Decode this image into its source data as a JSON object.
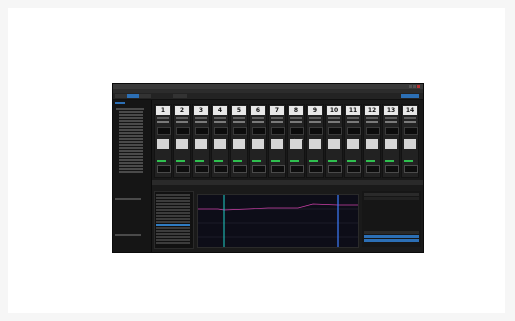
{
  "app": {
    "title": "",
    "menu": [
      "",
      "",
      "",
      "",
      "",
      ""
    ],
    "toolbar": {
      "items": [
        "",
        "",
        "",
        ""
      ],
      "active_index": 1
    }
  },
  "mixer": {
    "channels": [
      "1",
      "2",
      "3",
      "4",
      "5",
      "6",
      "7",
      "8",
      "9",
      "10",
      "11",
      "12",
      "13",
      "14"
    ]
  },
  "bottom": {
    "tabs": [
      "",
      "",
      "",
      "",
      "",
      ""
    ],
    "list_selected_index": 10
  },
  "colors": {
    "accent": "#2c6fb5",
    "meter_green": "#2fbf4f",
    "graph_cursor_teal": "#1fd1c8",
    "graph_cursor_blue": "#3d7cff",
    "graph_line": "#c93fa5"
  }
}
